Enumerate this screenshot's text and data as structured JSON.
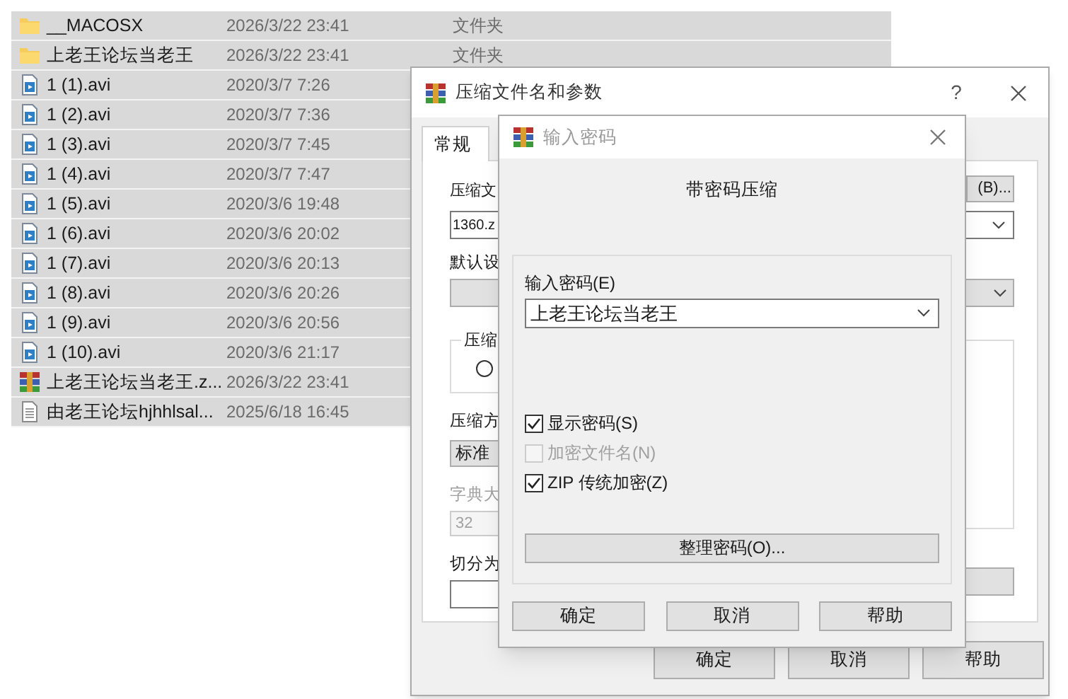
{
  "file_list": {
    "rows": [
      {
        "kind": "folder",
        "name": "__MACOSX",
        "date": "2026/3/22 23:41",
        "type": "文件夹",
        "selected": true
      },
      {
        "kind": "folder",
        "name": "上老王论坛当老王",
        "date": "2026/3/22 23:41",
        "type": "文件夹",
        "selected": true
      },
      {
        "kind": "video",
        "name": "1 (1).avi",
        "date": "2020/3/7 7:26",
        "selected": true
      },
      {
        "kind": "video",
        "name": "1 (2).avi",
        "date": "2020/3/7 7:36",
        "selected": true
      },
      {
        "kind": "video",
        "name": "1 (3).avi",
        "date": "2020/3/7 7:45",
        "selected": true
      },
      {
        "kind": "video",
        "name": "1 (4).avi",
        "date": "2020/3/7 7:47",
        "selected": true
      },
      {
        "kind": "video",
        "name": "1 (5).avi",
        "date": "2020/3/6 19:48",
        "selected": true
      },
      {
        "kind": "video",
        "name": "1 (6).avi",
        "date": "2020/3/6 20:02",
        "selected": true
      },
      {
        "kind": "video",
        "name": "1 (7).avi",
        "date": "2020/3/6 20:13",
        "selected": true
      },
      {
        "kind": "video",
        "name": "1 (8).avi",
        "date": "2020/3/6 20:26",
        "selected": true
      },
      {
        "kind": "video",
        "name": "1 (9).avi",
        "date": "2020/3/6 20:56",
        "selected": true
      },
      {
        "kind": "video",
        "name": "1 (10).avi",
        "date": "2020/3/6 21:17",
        "selected": true
      },
      {
        "kind": "archive",
        "name": "上老王论坛当老王.z...",
        "date": "2026/3/22 23:41",
        "selected": true
      },
      {
        "kind": "text",
        "name": "由老王论坛hjhhlsal...",
        "date": "2025/6/18 16:45",
        "selected": true
      }
    ]
  },
  "archive_dialog": {
    "title": "压缩文件名和参数",
    "help": "?",
    "tabs": [
      {
        "label": "常规",
        "selected": true
      }
    ],
    "archive_name_label": "压缩文",
    "browse_button": "(B)...",
    "archive_name_value": "1360.z",
    "profile_label": "默认设",
    "format_group_label": "压缩",
    "method_label": "压缩方",
    "method_value": "标准",
    "dictionary_label": "字典大",
    "dictionary_value": "32",
    "split_label": "切分为",
    "buttons": [
      "确定",
      "取消",
      "帮助"
    ]
  },
  "password_dialog": {
    "title": "输入密码",
    "heading": "带密码压缩",
    "password_label": "输入密码(E)",
    "password_value": "上老王论坛当老王",
    "checkboxes": [
      {
        "label": "显示密码(S)",
        "checked": true,
        "disabled": false
      },
      {
        "label": "加密文件名(N)",
        "checked": false,
        "disabled": true
      },
      {
        "label": "ZIP 传统加密(Z)",
        "checked": true,
        "disabled": false
      }
    ],
    "organize_button": "整理密码(O)...",
    "buttons": [
      "确定",
      "取消",
      "帮助"
    ]
  }
}
